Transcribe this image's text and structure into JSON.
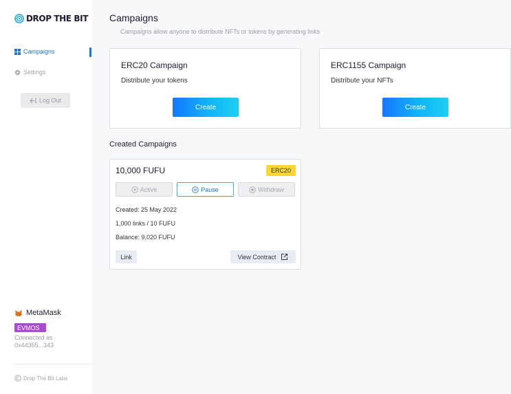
{
  "sidebar": {
    "logo_text": "DROP THE BIT",
    "nav": [
      {
        "label": "Campaigns",
        "icon": "grid-icon",
        "active": true
      },
      {
        "label": "Settings",
        "icon": "gear-icon",
        "active": false
      }
    ],
    "logout_label": "Log Out",
    "wallet": {
      "name": "MetaMask",
      "network": "EVMOS",
      "connected_label": "Connected as",
      "address": "0x44355...343"
    },
    "footer": "Drop The Bit Labs"
  },
  "main": {
    "title": "Campaigns",
    "subtitle": "Campaigns allow anyone to distribute NFTs or tokens by generating links",
    "types": [
      {
        "title": "ERC20 Campaign",
        "description": "Distribute your tokens",
        "button": "Create"
      },
      {
        "title": "ERC1155 Campaign",
        "description": "Distribute your NFTs",
        "button": "Create"
      }
    ],
    "created_title": "Created Campaigns",
    "campaign": {
      "amount": "10,000 FUFU",
      "token_type": "ERC20",
      "actions": {
        "active": "Active",
        "pause": "Pause",
        "withdraw": "Withdraw"
      },
      "created": "Created: 25 May 2022",
      "links": "1,000 links / 10 FUFU",
      "balance": "Balance: 9,020 FUFU",
      "link_label": "Link",
      "contract_label": "View Contract"
    }
  },
  "colors": {
    "accent": "#1b75d0",
    "badge_yellow": "#fdd835",
    "network_purple": "#a74bd6",
    "gradient_start": "#1677ff",
    "gradient_end": "#1ccff2"
  }
}
